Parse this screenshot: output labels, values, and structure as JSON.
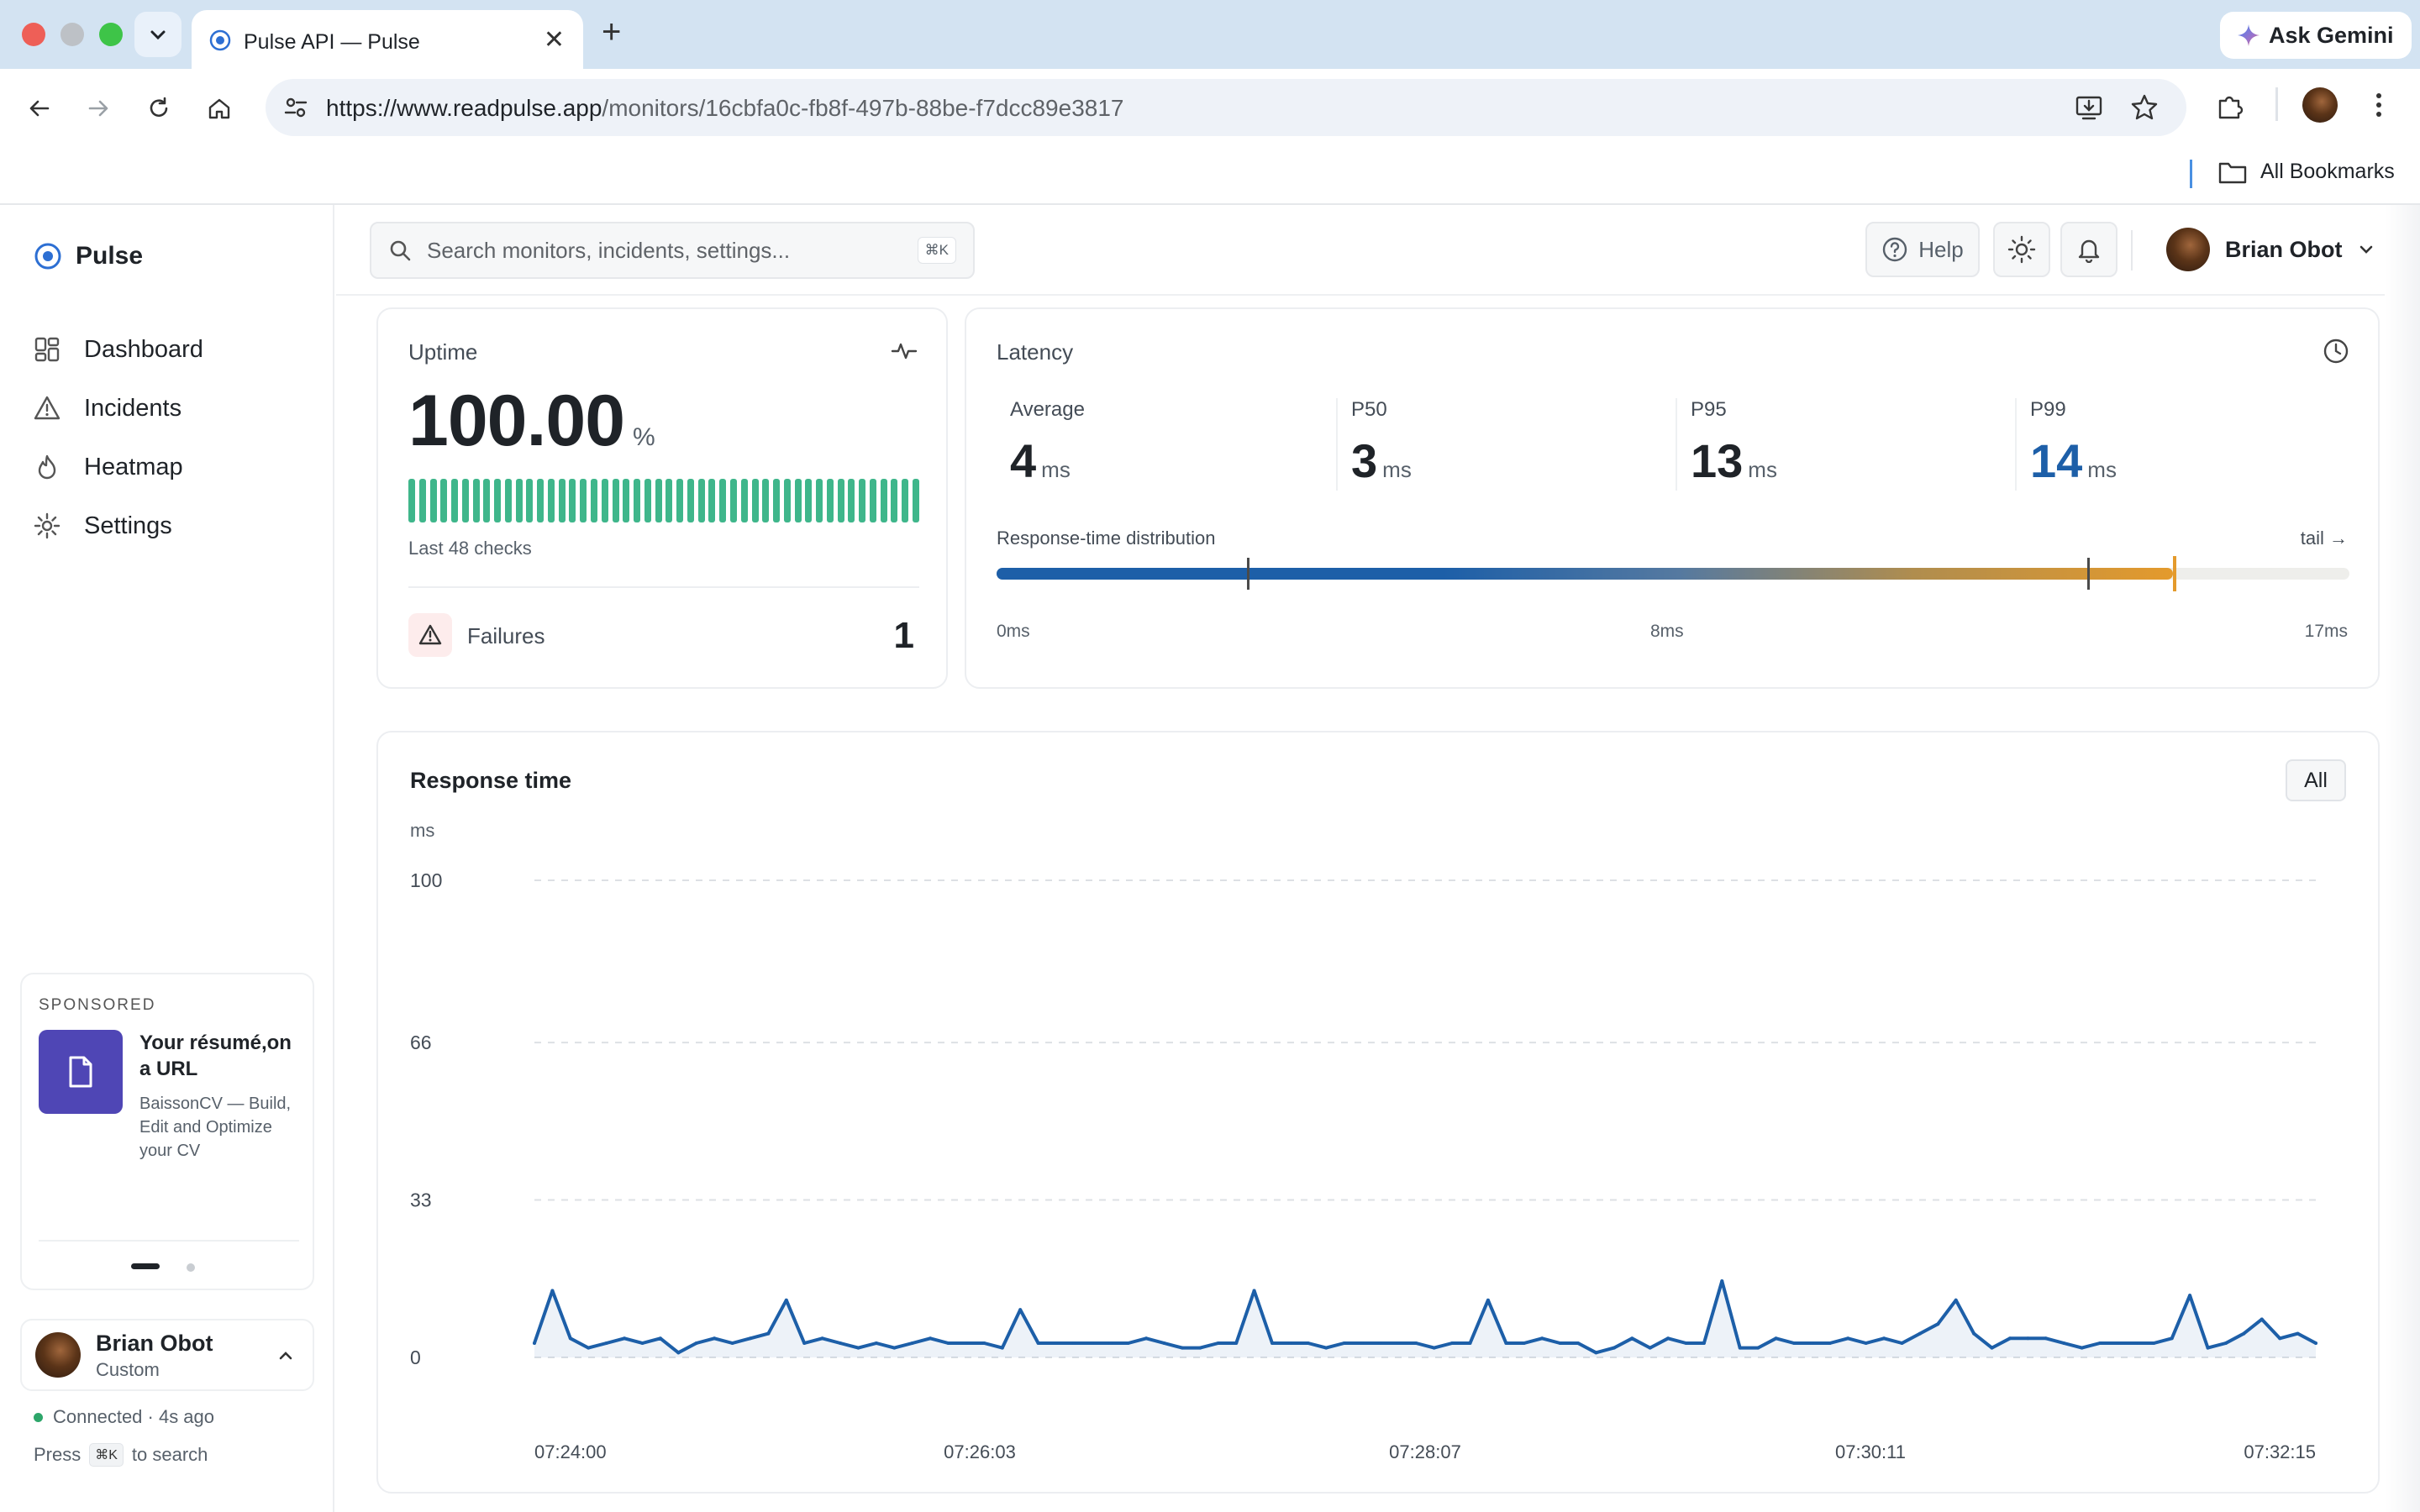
{
  "browser": {
    "tab_title": "Pulse API — Pulse",
    "new_tab": "+",
    "close": "✕",
    "ask_gemini": "Ask Gemini",
    "url_host": "https://www.readpulse.app",
    "url_path": "/monitors/16cbfa0c-fb8f-497b-88be-f7dcc89e3817",
    "all_bookmarks": "All Bookmarks"
  },
  "app": {
    "name": "Pulse",
    "nav": [
      {
        "label": "Dashboard",
        "icon": "grid-icon"
      },
      {
        "label": "Incidents",
        "icon": "warning-icon"
      },
      {
        "label": "Heatmap",
        "icon": "flame-icon"
      },
      {
        "label": "Settings",
        "icon": "gear-icon"
      }
    ],
    "promo": {
      "tag": "SPONSORED",
      "title": "Your résumé,on a URL",
      "desc": "BaissonCV — Build, Edit and Optimize your CV"
    },
    "user": {
      "name": "Brian Obot",
      "plan": "Custom"
    },
    "status": "Connected · 4s ago",
    "press_prefix": "Press",
    "press_key": "⌘K",
    "press_suffix": "to search"
  },
  "topbar": {
    "search_placeholder": "Search monitors, incidents, settings...",
    "search_shortcut": "⌘K",
    "help": "Help",
    "user_name": "Brian Obot"
  },
  "uptime": {
    "label": "Uptime",
    "value": "100.00",
    "unit": "%",
    "checks_label": "Last 48 checks",
    "checks_total": 48,
    "bar_color": "#3fb68b",
    "failures_label": "Failures",
    "failures_value": "1"
  },
  "latency": {
    "label": "Latency",
    "unit": "ms",
    "stats": [
      {
        "label": "Average",
        "value": "4"
      },
      {
        "label": "P50",
        "value": "3"
      },
      {
        "label": "P95",
        "value": "13"
      },
      {
        "label": "P99",
        "value": "14"
      }
    ],
    "highlight_color": "#1d5fa8",
    "dist_label": "Response-time distribution",
    "tail_label": "tail →",
    "scale_min": "0ms",
    "scale_mid": "8ms",
    "scale_max": "17ms"
  },
  "response_chart": {
    "title": "Response time",
    "range_button": "All"
  },
  "chart_data": {
    "type": "area",
    "title": "Response time",
    "ylabel": "ms",
    "xlabel": "",
    "ylim": [
      0,
      100
    ],
    "yticks": [
      0,
      33,
      66,
      100
    ],
    "xtick_labels": [
      "07:24:00",
      "07:26:03",
      "07:28:07",
      "07:30:11",
      "07:32:15"
    ],
    "grid": true,
    "line_color": "#1d5fa8",
    "series": [
      {
        "values": [
          3,
          14,
          4,
          2,
          3,
          4,
          3,
          4,
          1,
          3,
          4,
          3,
          4,
          5,
          12,
          3,
          4,
          3,
          2,
          3,
          2,
          3,
          4,
          3,
          3,
          3,
          2,
          10,
          3,
          3,
          3,
          3,
          3,
          3,
          4,
          3,
          2,
          2,
          3,
          3,
          14,
          3,
          3,
          3,
          2,
          3,
          3,
          3,
          3,
          3,
          2,
          3,
          3,
          12,
          3,
          3,
          4,
          3,
          3,
          1,
          2,
          4,
          2,
          4,
          3,
          3,
          16,
          2,
          2,
          4,
          3,
          3,
          3,
          4,
          3,
          4,
          3,
          5,
          7,
          12,
          5,
          2,
          4,
          4,
          4,
          3,
          2,
          3,
          3,
          3,
          3,
          4,
          13,
          2,
          3,
          5,
          8,
          4,
          5,
          3
        ]
      }
    ]
  }
}
